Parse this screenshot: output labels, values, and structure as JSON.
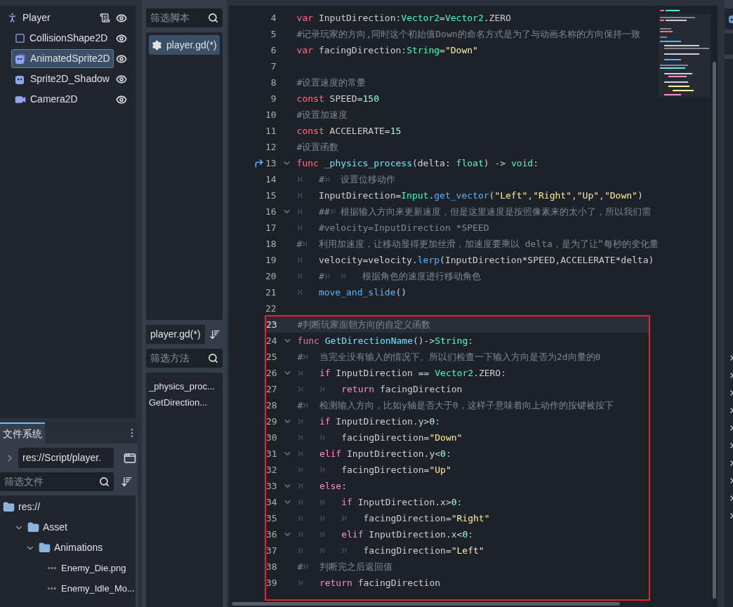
{
  "scene_tree": {
    "root": {
      "name": "Player",
      "kind": "person",
      "script": true,
      "visible": true,
      "selected": false,
      "children": [
        {
          "name": "CollisionShape2D",
          "kind": "collision",
          "visible": true,
          "selected": false
        },
        {
          "name": "AnimatedSprite2D",
          "kind": "animated",
          "visible": true,
          "selected": true
        },
        {
          "name": "Sprite2D_Shadow",
          "kind": "sprite",
          "visible": true,
          "selected": false
        },
        {
          "name": "Camera2D",
          "kind": "camera",
          "visible": true,
          "selected": false
        }
      ]
    }
  },
  "filesystem": {
    "tab": "文件系统",
    "path": "res://Script/player.",
    "filter": {
      "placeholder": "筛选文件"
    },
    "tree": [
      {
        "name": "res://",
        "kind": "folder",
        "children": [
          {
            "name": "Asset",
            "kind": "folder",
            "expanded": true,
            "children": [
              {
                "name": "Animations",
                "kind": "folder",
                "expanded": true,
                "children": [
                  {
                    "name": "Enemy_Die.png",
                    "kind": "image"
                  },
                  {
                    "name": "Enemy_Idle_Mo...",
                    "kind": "image"
                  }
                ]
              }
            ]
          }
        ]
      }
    ]
  },
  "script_panel": {
    "filter": {
      "placeholder": "筛选脚本"
    },
    "scripts": [
      {
        "name": "player.gd(*)",
        "selected": true
      }
    ],
    "current": "player.gd(*)",
    "method_filter": {
      "placeholder": "筛选方法"
    },
    "methods": [
      "_physics_proc...",
      "GetDirection..."
    ]
  },
  "editor": {
    "lines": [
      {
        "n": "4",
        "fold": false,
        "current": false,
        "connected": false,
        "tokens": [
          {
            "kind": "kw",
            "text": "var"
          },
          {
            "kind": "txt",
            "text": " InputDirection:"
          },
          {
            "kind": "type",
            "text": "Vector2"
          },
          {
            "kind": "txt",
            "text": "="
          },
          {
            "kind": "type",
            "text": "Vector2"
          },
          {
            "kind": "txt",
            "text": ".ZERO"
          }
        ]
      },
      {
        "n": "5",
        "fold": false,
        "current": false,
        "connected": false,
        "tokens": [
          {
            "kind": "cmt",
            "text": "#记录玩家的方向,同时这个初始值Down的命名方式是为了与动画名称的方向保持一致"
          }
        ]
      },
      {
        "n": "6",
        "fold": false,
        "current": false,
        "connected": false,
        "tokens": [
          {
            "kind": "kw",
            "text": "var"
          },
          {
            "kind": "txt",
            "text": " facingDirection:"
          },
          {
            "kind": "type",
            "text": "String"
          },
          {
            "kind": "txt",
            "text": "="
          },
          {
            "kind": "str",
            "text": "\"Down\""
          }
        ]
      },
      {
        "n": "7",
        "fold": false,
        "current": false,
        "connected": false
      },
      {
        "n": "8",
        "fold": false,
        "current": false,
        "connected": false,
        "tokens": [
          {
            "kind": "cmt",
            "text": "#设置速度的常量"
          }
        ]
      },
      {
        "n": "9",
        "fold": false,
        "current": false,
        "connected": false,
        "tokens": [
          {
            "kind": "kw",
            "text": "const"
          },
          {
            "kind": "txt",
            "text": " SPEED="
          },
          {
            "kind": "num",
            "text": "150"
          }
        ]
      },
      {
        "n": "10",
        "fold": false,
        "current": false,
        "connected": false,
        "tokens": [
          {
            "kind": "cmt",
            "text": "#设置加速度"
          }
        ]
      },
      {
        "n": "11",
        "fold": false,
        "current": false,
        "connected": false,
        "tokens": [
          {
            "kind": "kw",
            "text": "const"
          },
          {
            "kind": "txt",
            "text": " ACCELERATE="
          },
          {
            "kind": "num",
            "text": "15"
          }
        ]
      },
      {
        "n": "12",
        "fold": false,
        "current": false,
        "connected": false,
        "tokens": [
          {
            "kind": "cmt",
            "text": "#设置函数"
          }
        ]
      },
      {
        "n": "13",
        "fold": true,
        "current": false,
        "connected": true,
        "tokens": [
          {
            "kind": "kw",
            "text": "func"
          },
          {
            "kind": "fn",
            "text": " _physics_process"
          },
          {
            "kind": "txt",
            "text": "(delta: "
          },
          {
            "kind": "type",
            "text": "float"
          },
          {
            "kind": "txt",
            "text": ") -> "
          },
          {
            "kind": "type",
            "text": "void"
          },
          {
            "kind": "txt",
            "text": ":"
          }
        ]
      },
      {
        "n": "14",
        "fold": false,
        "current": false,
        "connected": false,
        "tokens": [
          {
            "kind": "tab"
          },
          {
            "kind": "cmt",
            "text": "#"
          },
          {
            "kind": "tab"
          },
          {
            "kind": "cmt",
            "text": "设置位移动作"
          }
        ]
      },
      {
        "n": "15",
        "fold": false,
        "current": false,
        "connected": false,
        "tokens": [
          {
            "kind": "tab"
          },
          {
            "kind": "txt",
            "text": "InputDirection="
          },
          {
            "kind": "type",
            "text": "Input"
          },
          {
            "kind": "txt",
            "text": "."
          },
          {
            "kind": "call",
            "text": "get_vector"
          },
          {
            "kind": "txt",
            "text": "("
          },
          {
            "kind": "str",
            "text": "\"Left\""
          },
          {
            "kind": "txt",
            "text": ","
          },
          {
            "kind": "str",
            "text": "\"Right\""
          },
          {
            "kind": "txt",
            "text": ","
          },
          {
            "kind": "str",
            "text": "\"Up\""
          },
          {
            "kind": "txt",
            "text": ","
          },
          {
            "kind": "str",
            "text": "\"Down\""
          },
          {
            "kind": "txt",
            "text": ")"
          }
        ]
      },
      {
        "n": "16",
        "fold": true,
        "current": false,
        "connected": false,
        "tokens": [
          {
            "kind": "tab"
          },
          {
            "kind": "cmt",
            "text": "##"
          },
          {
            "kind": "tab"
          },
          {
            "kind": "cmt",
            "text": "根据输入方向来更新速度，但是这里速度是按照像素来的太小了，所以我们需"
          }
        ]
      },
      {
        "n": "17",
        "fold": false,
        "current": false,
        "connected": false,
        "tokens": [
          {
            "kind": "tab"
          },
          {
            "kind": "cmt",
            "text": "#velocity=InputDirection *SPEED"
          }
        ]
      },
      {
        "n": "18",
        "fold": false,
        "current": false,
        "connected": false,
        "tokens": [
          {
            "kind": "cmt",
            "text": "#"
          },
          {
            "kind": "tab"
          },
          {
            "kind": "cmt",
            "text": "利用加速度，让移动显得更加丝滑，加速度要乘以 delta，是为了让“每秒的变化量"
          }
        ]
      },
      {
        "n": "19",
        "fold": false,
        "current": false,
        "connected": false,
        "tokens": [
          {
            "kind": "tab"
          },
          {
            "kind": "txt",
            "text": "velocity=velocity."
          },
          {
            "kind": "call",
            "text": "lerp"
          },
          {
            "kind": "txt",
            "text": "(InputDirection*SPEED,ACCELERATE*delta)"
          }
        ]
      },
      {
        "n": "20",
        "fold": false,
        "current": false,
        "connected": false,
        "tokens": [
          {
            "kind": "tab"
          },
          {
            "kind": "cmt",
            "text": "#"
          },
          {
            "kind": "tab"
          },
          {
            "kind": "tab"
          },
          {
            "kind": "cmt",
            "text": "根据角色的速度进行移动角色"
          }
        ]
      },
      {
        "n": "21",
        "fold": false,
        "current": false,
        "connected": false,
        "tokens": [
          {
            "kind": "tab"
          },
          {
            "kind": "call",
            "text": "move_and_slide"
          },
          {
            "kind": "txt",
            "text": "()"
          }
        ]
      },
      {
        "n": "22",
        "fold": false,
        "current": false,
        "connected": false
      }
    ],
    "annotated_lines": [
      {
        "n": "23",
        "fold": false,
        "current": true,
        "tokens": [
          {
            "kind": "cmt",
            "text": "#判断玩家面朝方向的自定义函数"
          }
        ]
      },
      {
        "n": "24",
        "fold": true,
        "current": false,
        "tokens": [
          {
            "kind": "kw",
            "text": "func"
          },
          {
            "kind": "fn",
            "text": " GetDirectionName"
          },
          {
            "kind": "txt",
            "text": "()->"
          },
          {
            "kind": "type",
            "text": "String"
          },
          {
            "kind": "txt",
            "text": ":"
          }
        ]
      },
      {
        "n": "25",
        "fold": false,
        "current": false,
        "tokens": [
          {
            "kind": "cmt",
            "text": "#"
          },
          {
            "kind": "tab"
          },
          {
            "kind": "cmt",
            "text": "当完全没有输入的情况下。所以们检查一下输入方向是否为2d向量的0"
          }
        ]
      },
      {
        "n": "26",
        "fold": true,
        "current": false,
        "tokens": [
          {
            "kind": "tab"
          },
          {
            "kind": "ctrl",
            "text": "if"
          },
          {
            "kind": "txt",
            "text": " InputDirection == "
          },
          {
            "kind": "type",
            "text": "Vector2"
          },
          {
            "kind": "txt",
            "text": ".ZERO:"
          }
        ]
      },
      {
        "n": "27",
        "fold": false,
        "current": false,
        "tokens": [
          {
            "kind": "tab"
          },
          {
            "kind": "tab"
          },
          {
            "kind": "ctrl",
            "text": "return"
          },
          {
            "kind": "txt",
            "text": " facingDirection"
          }
        ]
      },
      {
        "n": "28",
        "fold": false,
        "current": false,
        "tokens": [
          {
            "kind": "cmt",
            "text": "#"
          },
          {
            "kind": "tab"
          },
          {
            "kind": "cmt",
            "text": "检测输入方向，比如y轴是否大于0，这样子意味着向上动作的按键被按下"
          }
        ]
      },
      {
        "n": "29",
        "fold": true,
        "current": false,
        "tokens": [
          {
            "kind": "tab"
          },
          {
            "kind": "ctrl",
            "text": "if"
          },
          {
            "kind": "txt",
            "text": " InputDirection.y>"
          },
          {
            "kind": "num",
            "text": "0"
          },
          {
            "kind": "txt",
            "text": ":"
          }
        ]
      },
      {
        "n": "30",
        "fold": false,
        "current": false,
        "tokens": [
          {
            "kind": "tab"
          },
          {
            "kind": "tab"
          },
          {
            "kind": "txt",
            "text": "facingDirection="
          },
          {
            "kind": "str",
            "text": "\"Down\""
          }
        ]
      },
      {
        "n": "31",
        "fold": true,
        "current": false,
        "tokens": [
          {
            "kind": "tab"
          },
          {
            "kind": "ctrl",
            "text": "elif"
          },
          {
            "kind": "txt",
            "text": " InputDirection.y<"
          },
          {
            "kind": "num",
            "text": "0"
          },
          {
            "kind": "txt",
            "text": ":"
          }
        ]
      },
      {
        "n": "32",
        "fold": false,
        "current": false,
        "tokens": [
          {
            "kind": "tab"
          },
          {
            "kind": "tab"
          },
          {
            "kind": "txt",
            "text": "facingDirection="
          },
          {
            "kind": "str",
            "text": "\"Up\""
          }
        ]
      },
      {
        "n": "33",
        "fold": true,
        "current": false,
        "tokens": [
          {
            "kind": "tab"
          },
          {
            "kind": "ctrl",
            "text": "else"
          },
          {
            "kind": "txt",
            "text": ":"
          }
        ]
      },
      {
        "n": "34",
        "fold": true,
        "current": false,
        "tokens": [
          {
            "kind": "tab"
          },
          {
            "kind": "tab"
          },
          {
            "kind": "ctrl",
            "text": "if"
          },
          {
            "kind": "txt",
            "text": " InputDirection.x>"
          },
          {
            "kind": "num",
            "text": "0"
          },
          {
            "kind": "txt",
            "text": ":"
          }
        ]
      },
      {
        "n": "35",
        "fold": false,
        "current": false,
        "tokens": [
          {
            "kind": "tab"
          },
          {
            "kind": "tab"
          },
          {
            "kind": "tab"
          },
          {
            "kind": "txt",
            "text": "facingDirection="
          },
          {
            "kind": "str",
            "text": "\"Right\""
          }
        ]
      },
      {
        "n": "36",
        "fold": true,
        "current": false,
        "tokens": [
          {
            "kind": "tab"
          },
          {
            "kind": "tab"
          },
          {
            "kind": "ctrl",
            "text": "elif"
          },
          {
            "kind": "txt",
            "text": " InputDirection.x<"
          },
          {
            "kind": "num",
            "text": "0"
          },
          {
            "kind": "txt",
            "text": ":"
          }
        ]
      },
      {
        "n": "37",
        "fold": false,
        "current": false,
        "tokens": [
          {
            "kind": "tab"
          },
          {
            "kind": "tab"
          },
          {
            "kind": "tab"
          },
          {
            "kind": "txt",
            "text": "facingDirection="
          },
          {
            "kind": "str",
            "text": "\"Left\""
          }
        ]
      },
      {
        "n": "38",
        "fold": false,
        "current": false,
        "tokens": [
          {
            "kind": "cmt",
            "text": "#"
          },
          {
            "kind": "tab"
          },
          {
            "kind": "cmt",
            "text": "判断完之后返回值"
          }
        ]
      },
      {
        "n": "39",
        "fold": false,
        "current": false,
        "tokens": [
          {
            "kind": "tab"
          },
          {
            "kind": "ctrl",
            "text": "return"
          },
          {
            "kind": "txt",
            "text": " facingDirection"
          }
        ]
      }
    ]
  }
}
